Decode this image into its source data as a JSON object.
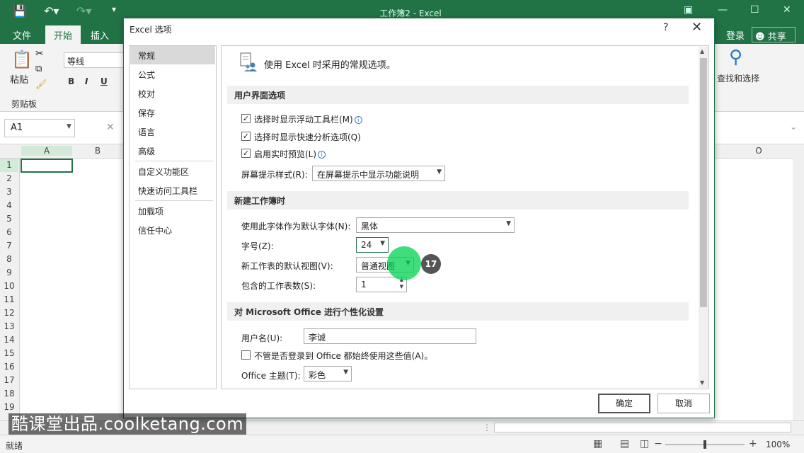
{
  "app": {
    "window_title": "工作簿2 - Excel",
    "tabs": [
      "文件",
      "开始",
      "插入"
    ],
    "active_tab": "开始",
    "login_label": "登录",
    "share_label": "共享"
  },
  "ribbon": {
    "paste_label": "粘贴",
    "clipboard_label": "剪贴板",
    "font_name": "等线",
    "bold": "B",
    "italic": "I",
    "underline": "U",
    "find_select_label": "查找和选择"
  },
  "formula_bar": {
    "name_box": "A1"
  },
  "grid": {
    "columns": [
      "A",
      "B",
      "O"
    ],
    "rows": [
      "1",
      "2",
      "3",
      "4",
      "5",
      "6",
      "7",
      "8",
      "9",
      "10",
      "11",
      "12",
      "13",
      "14",
      "15",
      "16",
      "17",
      "18",
      "19"
    ]
  },
  "status": {
    "ready": "就绪",
    "zoom": "100%"
  },
  "watermark": "酷课堂出品.coolketang.com",
  "dialog": {
    "title": "Excel 选项",
    "help": "?",
    "close": "✕",
    "nav": [
      "常规",
      "公式",
      "校对",
      "保存",
      "语言",
      "高级",
      "自定义功能区",
      "快速访问工具栏",
      "加载项",
      "信任中心"
    ],
    "active_nav": "常规",
    "header": "使用 Excel 时采用的常规选项。",
    "section_ui": "用户界面选项",
    "opt_mini_toolbar": "选择时显示浮动工具栏(M)",
    "opt_quick_analysis": "选择时显示快速分析选项(Q)",
    "opt_live_preview": "启用实时预览(L)",
    "screentip_label": "屏幕提示样式(R):",
    "screentip_value": "在屏幕提示中显示功能说明",
    "section_new": "新建工作簿时",
    "font_label": "使用此字体作为默认字体(N):",
    "font_value": "黑体",
    "size_label": "字号(Z):",
    "size_value": "24",
    "view_label": "新工作表的默认视图(V):",
    "view_value": "普通视图",
    "sheets_label": "包含的工作表数(S):",
    "sheets_value": "1",
    "section_personal": "对 Microsoft Office 进行个性化设置",
    "user_label": "用户名(U):",
    "user_value": "李诚",
    "always_label": "不管是否登录到 Office 都始终使用这些值(A)。",
    "theme_label": "Office 主题(T):",
    "theme_value": "彩色",
    "ok": "确定",
    "cancel": "取消"
  },
  "step_number": "17"
}
